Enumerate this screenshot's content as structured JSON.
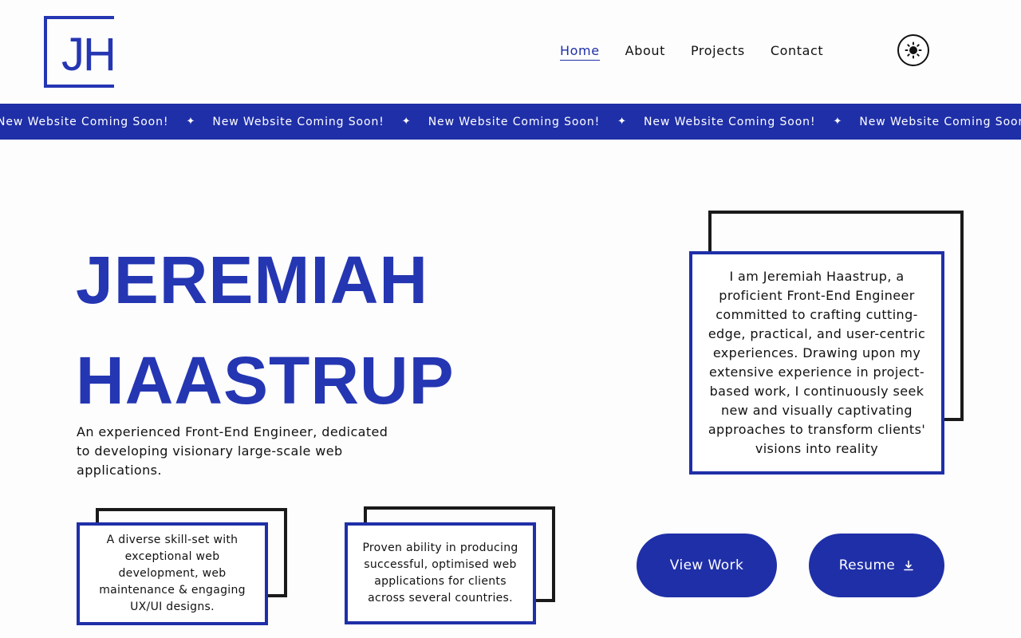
{
  "logo": {
    "text": "JH",
    "color": "#2536b3"
  },
  "nav": {
    "items": [
      {
        "label": "Home",
        "active": true
      },
      {
        "label": "About",
        "active": false
      },
      {
        "label": "Projects",
        "active": false
      },
      {
        "label": "Contact",
        "active": false
      }
    ]
  },
  "theme_toggle": {
    "icon": "sun-icon"
  },
  "marquee": {
    "text": "New Website Coming Soon!",
    "separator": "✦",
    "background": "#1f2fa8"
  },
  "hero": {
    "name_line1": "JEREMIAH",
    "name_line2": "HAASTRUP",
    "subtitle": "An experienced Front-End Engineer, dedicated to developing visionary large-scale web applications."
  },
  "about_card": {
    "text": "I am Jeremiah Haastrup, a proficient Front-End Engineer committed to crafting cutting-edge, practical, and user-centric experiences. Drawing upon my extensive experience in project-based work, I continuously seek new and visually captivating approaches to transform clients' visions into reality"
  },
  "feature_cards": [
    {
      "text": "A diverse skill-set with exceptional web development, web maintenance & engaging UX/UI designs."
    },
    {
      "text": "Proven ability in producing successful, optimised web applications for clients across several countries."
    }
  ],
  "buttons": {
    "view_work": "View Work",
    "resume": "Resume",
    "resume_icon": "download-icon"
  },
  "colors": {
    "accent": "#1f2fa8",
    "heading": "#2536b3",
    "shadow_border": "#1a1a1a"
  }
}
